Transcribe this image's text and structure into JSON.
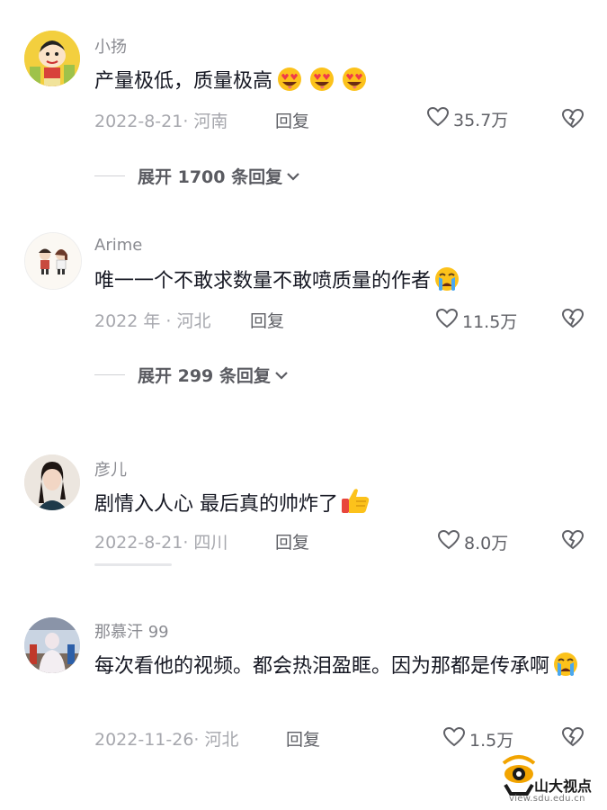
{
  "comments": [
    {
      "username": "小扬",
      "text": "产量极低，质量极高",
      "emoji": [
        "heart-eyes-emoji",
        "heart-eyes-emoji",
        "heart-eyes-emoji"
      ],
      "meta": "2022-8-21· 河南",
      "reply_label": "回复",
      "likes": "35.7万",
      "expand_label": "展开 1700 条回复"
    },
    {
      "username": "Arime",
      "text": "唯一一个不敢求数量不敢喷质量的作者",
      "emoji": [
        "crying-emoji"
      ],
      "meta": "2022 年 · 河北",
      "reply_label": "回复",
      "likes": "11.5万",
      "expand_label": "展开 299 条回复"
    },
    {
      "username": "彦儿",
      "text": "剧情入人心 最后真的帅炸了",
      "emoji": [
        "thumbs-up-emoji"
      ],
      "meta": "2022-8-21· 四川",
      "reply_label": "回复",
      "likes": "8.0万"
    },
    {
      "username": "那慕汗 99",
      "text": "每次看他的视频。都会热泪盈眶。因为那都是传承啊",
      "emoji": [
        "crying-emoji"
      ],
      "meta": "2022-11-26· 河北",
      "reply_label": "回复",
      "likes": "1.5万"
    }
  ],
  "watermark": {
    "title": "山大视点",
    "url": "view.sdu.edu.cn"
  },
  "colors": {
    "text": "#161823",
    "secondary": "#8a8b91",
    "meta": "#a6a7ad",
    "accent_logo": "#f2a400"
  }
}
